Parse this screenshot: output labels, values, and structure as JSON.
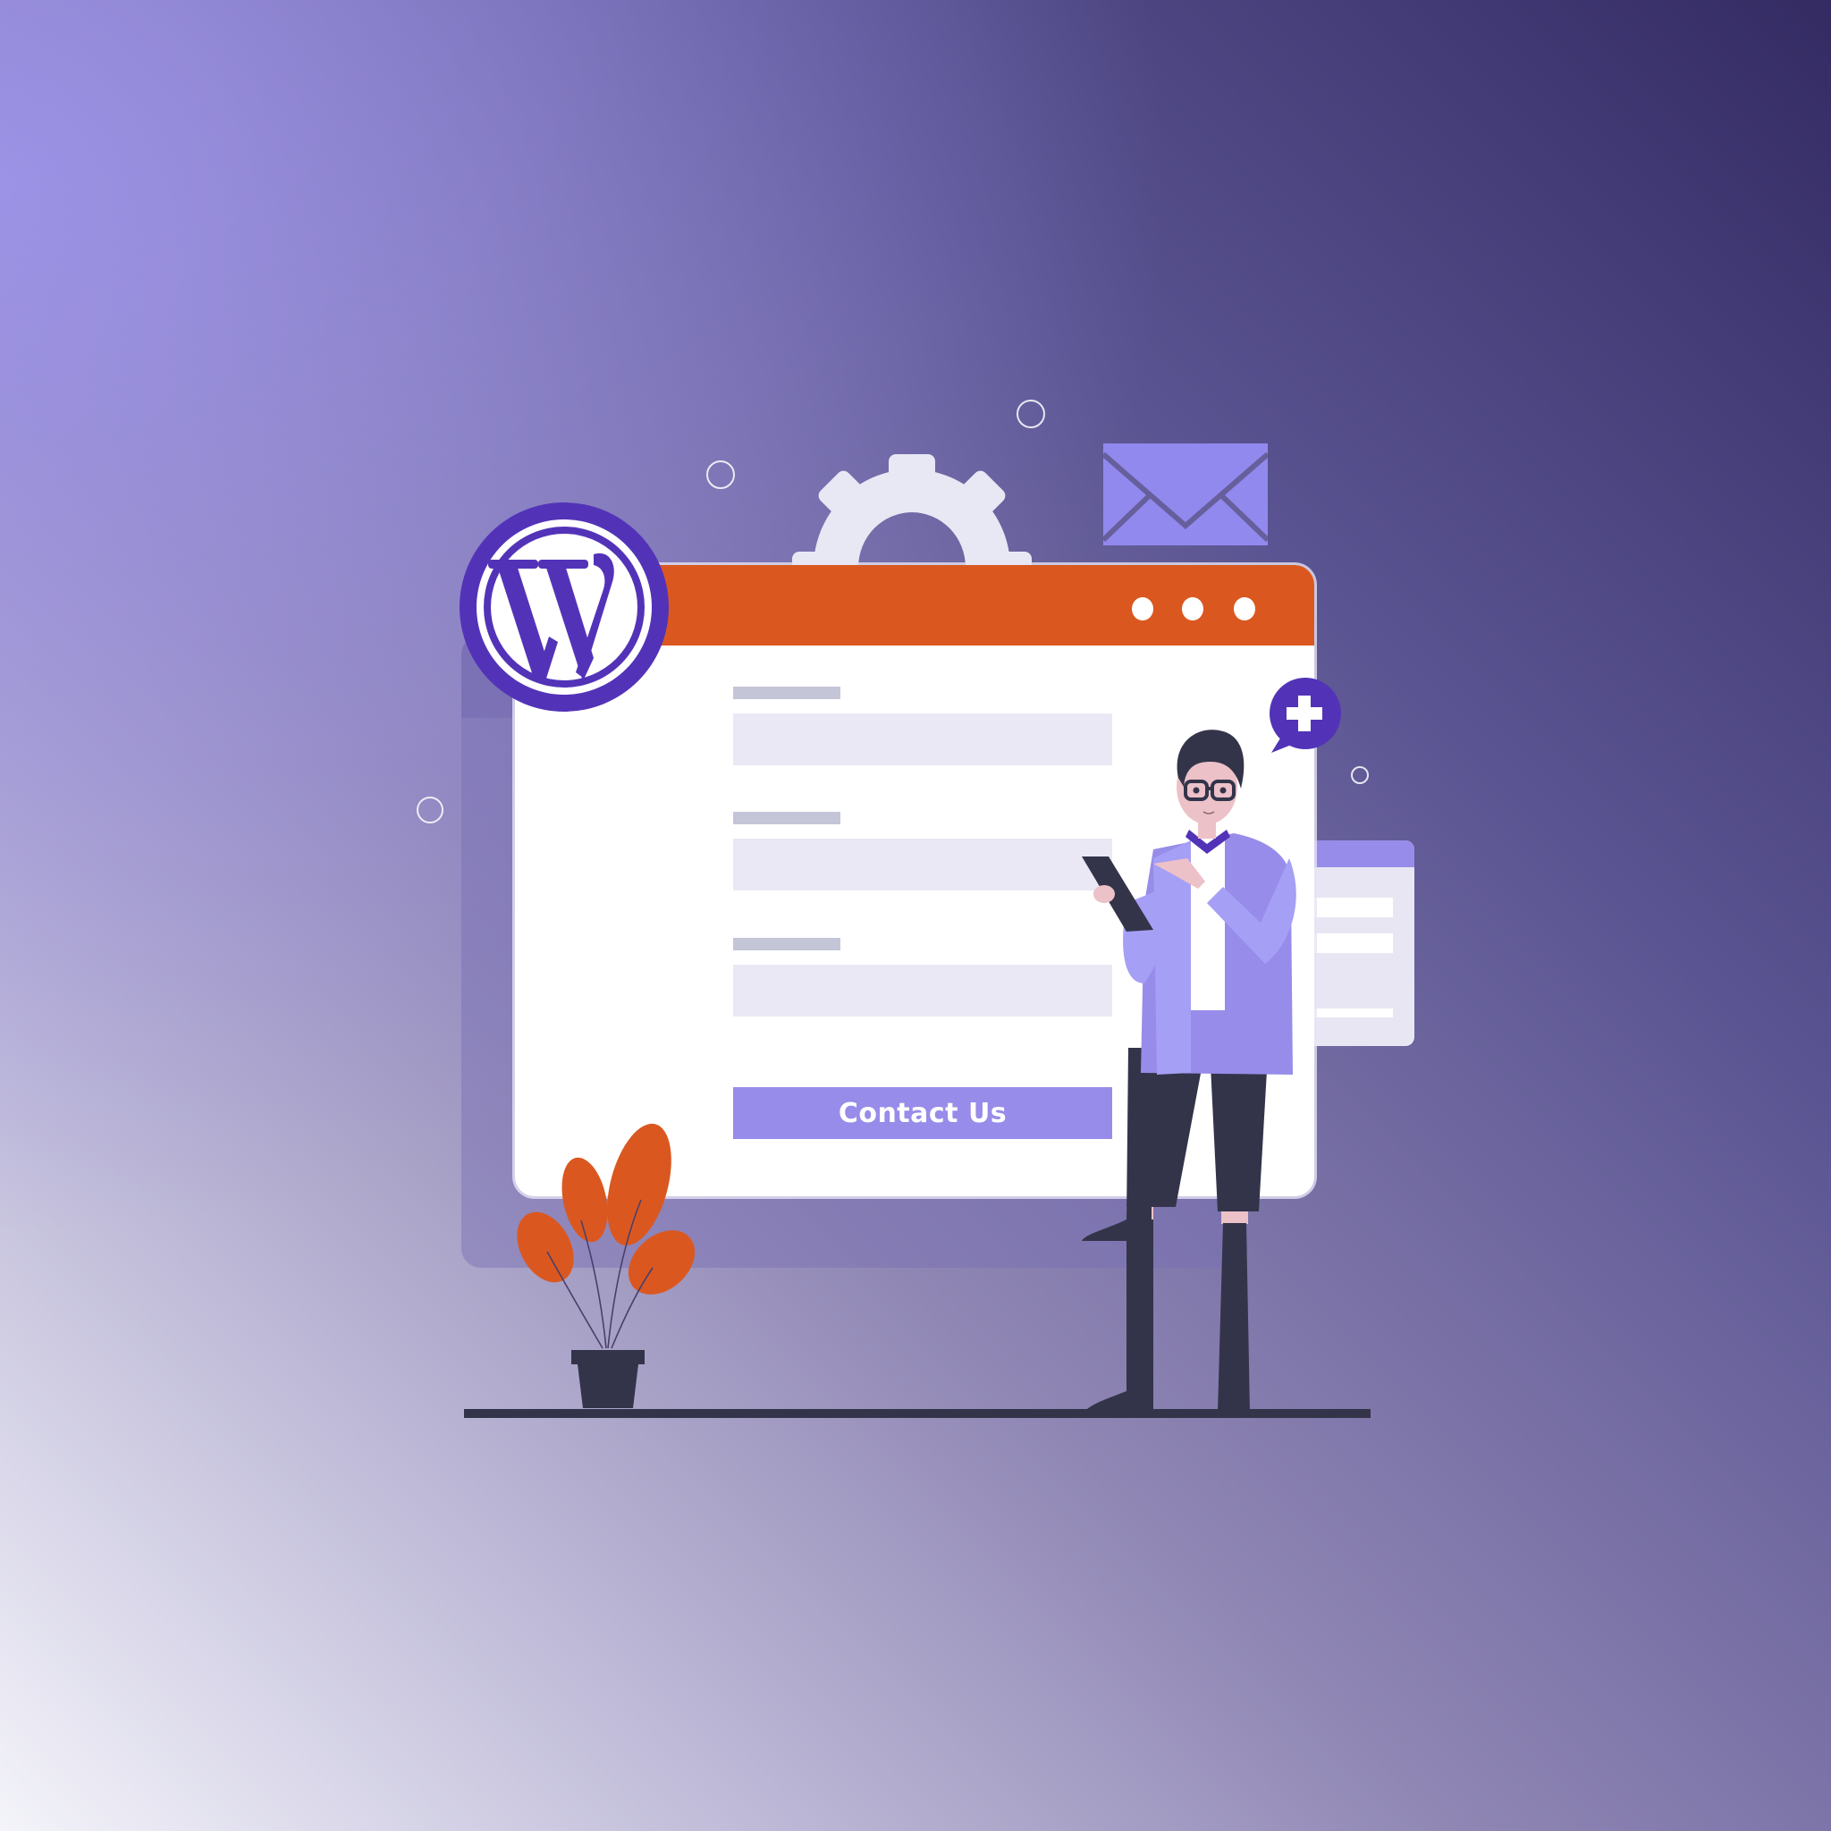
{
  "illustration": {
    "subject": "WordPress contact form",
    "colors": {
      "brand_purple": "#5233b8",
      "accent_orange": "#da5820",
      "button_lavender": "#978ce9",
      "field_fill": "#e9e8f4",
      "label_gray": "#c5c5d8",
      "dark_navy": "#33344a"
    }
  },
  "logo": {
    "icon": "wordpress-logo",
    "letter": "W"
  },
  "window": {
    "titlebar_controls": [
      "dot",
      "dot",
      "dot"
    ],
    "form": {
      "fields": [
        {
          "label": "",
          "value": ""
        },
        {
          "label": "",
          "value": ""
        },
        {
          "label": "",
          "value": ""
        }
      ],
      "submit_label": "Contact Us"
    }
  },
  "decorations": {
    "icons": [
      "gear-icon",
      "envelope-icon",
      "plus-speech-bubble-icon",
      "plant-icon",
      "person-with-tablet"
    ]
  }
}
